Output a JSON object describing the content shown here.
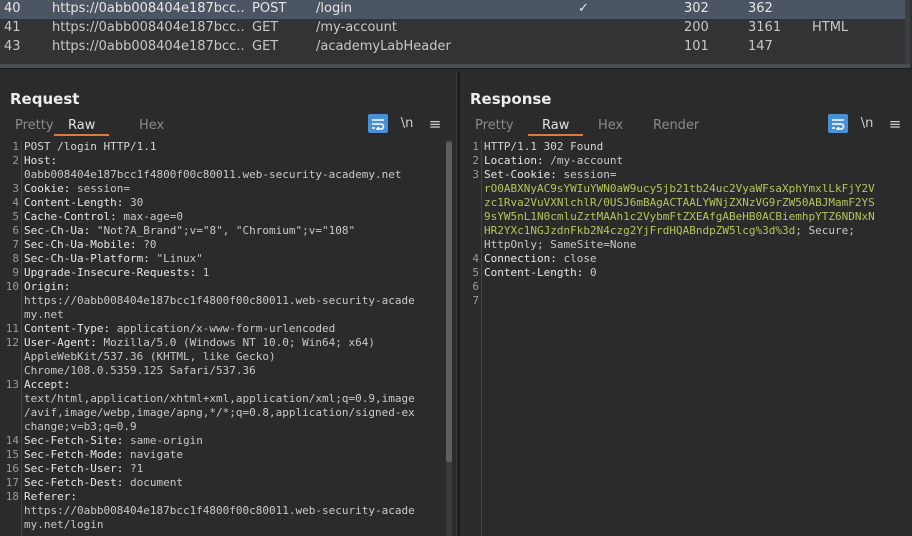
{
  "history": {
    "rows": [
      {
        "num": "40",
        "host": "https://0abb008404e187bcc...",
        "method": "POST",
        "url": "/login",
        "edited": "✓",
        "status": "302",
        "length": "362",
        "mime": "",
        "selected": true
      },
      {
        "num": "41",
        "host": "https://0abb008404e187bcc...",
        "method": "GET",
        "url": "/my-account",
        "edited": "",
        "status": "200",
        "length": "3161",
        "mime": "HTML",
        "selected": false
      },
      {
        "num": "43",
        "host": "https://0abb008404e187bcc...",
        "method": "GET",
        "url": "/academyLabHeader",
        "edited": "",
        "status": "101",
        "length": "147",
        "mime": "",
        "selected": false
      }
    ]
  },
  "layout_toggle": {
    "options": [
      "split-horizontal-icon",
      "split-vertical-icon",
      "single-pane-icon"
    ],
    "active": "split-horizontal-icon"
  },
  "request": {
    "title": "Request",
    "tabs": [
      "Pretty",
      "Raw",
      "Hex"
    ],
    "active_tab": "Raw",
    "tools": {
      "newline": "\\n",
      "menu": "≡"
    },
    "lines": [
      {
        "n": "1",
        "text": [
          "POST /login HTTP/1.1"
        ]
      },
      {
        "n": "2",
        "key": "Host:",
        "text": [
          "",
          "0abb008404e187bcc1f4800f00c80011.web-security-academy.net"
        ]
      },
      {
        "n": "3",
        "key": "Cookie:",
        "value": " session="
      },
      {
        "n": "4",
        "key": "Content-Length:",
        "value": " 30"
      },
      {
        "n": "5",
        "key": "Cache-Control:",
        "value": " max-age=0"
      },
      {
        "n": "6",
        "key": "Sec-Ch-Ua:",
        "value": " \"Not?A_Brand\";v=\"8\", \"Chromium\";v=\"108\""
      },
      {
        "n": "7",
        "key": "Sec-Ch-Ua-Mobile:",
        "value": " ?0"
      },
      {
        "n": "8",
        "key": "Sec-Ch-Ua-Platform:",
        "value": " \"Linux\""
      },
      {
        "n": "9",
        "key": "Upgrade-Insecure-Requests:",
        "value": " 1"
      },
      {
        "n": "10",
        "key": "Origin:",
        "text": [
          "",
          "https://0abb008404e187bcc1f4800f00c80011.web-security-acade",
          "my.net"
        ]
      },
      {
        "n": "11",
        "key": "Content-Type:",
        "value": " application/x-www-form-urlencoded"
      },
      {
        "n": "12",
        "key": "User-Agent:",
        "value": " Mozilla/5.0 (Windows NT 10.0; Win64; x64)",
        "text": [
          "",
          "AppleWebKit/537.36 (KHTML, like Gecko)",
          "Chrome/108.0.5359.125 Safari/537.36"
        ]
      },
      {
        "n": "13",
        "key": "Accept:",
        "text": [
          "",
          "text/html,application/xhtml+xml,application/xml;q=0.9,image",
          "/avif,image/webp,image/apng,*/*;q=0.8,application/signed-ex",
          "change;v=b3;q=0.9"
        ]
      },
      {
        "n": "14",
        "key": "Sec-Fetch-Site:",
        "value": " same-origin"
      },
      {
        "n": "15",
        "key": "Sec-Fetch-Mode:",
        "value": " navigate"
      },
      {
        "n": "16",
        "key": "Sec-Fetch-User:",
        "value": " ?1"
      },
      {
        "n": "17",
        "key": "Sec-Fetch-Dest:",
        "value": " document"
      },
      {
        "n": "18",
        "key": "Referer:",
        "text": [
          "",
          "https://0abb008404e187bcc1f4800f00c80011.web-security-acade",
          "my.net/login"
        ]
      }
    ]
  },
  "response": {
    "title": "Response",
    "tabs": [
      "Pretty",
      "Raw",
      "Hex",
      "Render"
    ],
    "active_tab": "Raw",
    "tools": {
      "newline": "\\n",
      "menu": "≡"
    },
    "lines": [
      {
        "n": "1",
        "text": [
          "HTTP/1.1 302 Found"
        ]
      },
      {
        "n": "2",
        "key": "Location:",
        "value": " /my-account"
      },
      {
        "n": "3",
        "key": "Set-Cookie:",
        "value": " session=",
        "cookie": [
          "rO0ABXNyAC9sYWIuYWN0aW9ucy5jb21tb24uc2VyaWFsaXphYmxlLkFjY2V",
          "zc1Rva2VuVXNlchlR/0USJ6mBAgACTAALYWNjZXNzVG9rZW50ABJMamF2YS",
          "9sYW5nL1N0cmluZztMAAh1c2VybmFtZXEAfgABeHB0ACBiemhpYTZ6NDNxN",
          "HR2YXc1NGJzdnFkb2N4czg2YjFrdHQABndpZW5lcg%3d%3d"
        ],
        "tail": "; Secure;",
        "text": [
          "",
          "",
          "",
          "",
          "",
          "HttpOnly; SameSite=None"
        ]
      },
      {
        "n": "4",
        "key": "Connection:",
        "value": " close"
      },
      {
        "n": "5",
        "key": "Content-Length:",
        "value": " 0"
      },
      {
        "n": "6",
        "text": [
          ""
        ]
      },
      {
        "n": "7",
        "text": [
          ""
        ]
      }
    ]
  }
}
